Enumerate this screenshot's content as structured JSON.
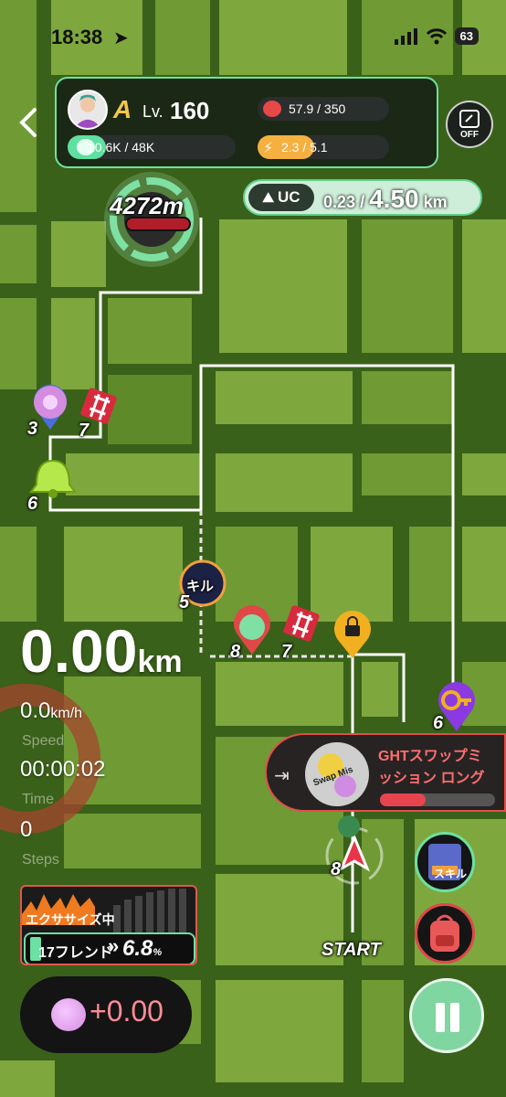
{
  "status_bar": {
    "time": "18:38",
    "battery": "63"
  },
  "player": {
    "rank": "A",
    "level_label": "Lv.",
    "level": "160"
  },
  "resources": {
    "energy": "57.9 / 350",
    "points": "10.6K / 48K",
    "stamina": "2.3 / 5.1"
  },
  "off_button": {
    "label": "OFF"
  },
  "uc": {
    "tag": "UC",
    "current": "0.23",
    "separator": "/",
    "target": "4.50",
    "unit": "km"
  },
  "map": {
    "goal_distance": "4272m",
    "start_label": "START",
    "markers": [
      "3",
      "7",
      "6",
      "5",
      "8",
      "7",
      "6",
      "8"
    ],
    "skill_marker": "キル"
  },
  "stats": {
    "distance_value": "0.00",
    "distance_unit": "km",
    "speed_value": "0.0",
    "speed_unit": "km/h",
    "speed_label": "Speed",
    "time_value": "00:00:02",
    "time_label": "Time",
    "steps_value": "0",
    "steps_label": "Steps"
  },
  "exercise": {
    "title": "エクササイズ中",
    "friend": "17フレンド",
    "arrows": "»",
    "percent_value": "6.8",
    "percent_unit": "%"
  },
  "token": {
    "value": "+0.00"
  },
  "mission": {
    "image_text": "Swap Mis",
    "title_line1": "GHTスワップミ",
    "title_line2": "ッション ロング",
    "progress": 0.4
  },
  "side_buttons": {
    "skill_label": "スキル"
  }
}
